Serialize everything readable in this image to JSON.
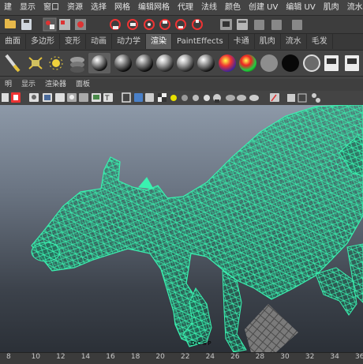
{
  "menu": [
    "建",
    "显示",
    "窗口",
    "资源",
    "选择",
    "网格",
    "编辑网格",
    "代理",
    "法线",
    "颜色",
    "创建 UV",
    "编辑 UV",
    "肌肉",
    "流水线缓"
  ],
  "shelf_tabs": [
    "曲面",
    "多边形",
    "变形",
    "动画",
    "动力学",
    "渲染",
    "PaintEffects",
    "卡通",
    "肌肉",
    "流水",
    "毛发"
  ],
  "active_shelf_tab": "渲染",
  "panel_menu": [
    "明",
    "显示",
    "渲染器",
    "面板"
  ],
  "timeline_ticks": [
    "8",
    "10",
    "12",
    "14",
    "16",
    "18",
    "20",
    "22",
    "24",
    "26",
    "28",
    "30",
    "32",
    "34",
    "36"
  ],
  "viewport_label": "D C S P",
  "colors": {
    "wireframe": "#2ee6a0",
    "shelf_tab_active": "#5d5d5d",
    "ui_background": "#444444"
  },
  "icons": {
    "status": [
      "folder-icon",
      "save-icon",
      "select-by-hierarchy-icon",
      "select-by-object-icon",
      "snap-grid-icon",
      "snap-curve-icon",
      "snap-point-icon",
      "snap-surface-icon",
      "history-icon",
      "render-icon",
      "ipr-render-icon",
      "render-settings-icon",
      "hypershade-icon"
    ],
    "shelf": [
      "paint-brush-icon",
      "light-icon",
      "sun-icon",
      "stack-icon",
      "sphere-shader-icon",
      "blinn-ball-icon",
      "phong-ball-icon",
      "lambert-ball-icon",
      "anisotropic-ball-icon",
      "ramp-ball-icon",
      "surface-ball-icon",
      "grey-ball-icon",
      "black-ball-icon",
      "white-ball-icon",
      "render-view-icon",
      "batch-render-icon",
      "hypershade-window-icon"
    ],
    "panel_toolbar": [
      "camera-icon",
      "lock-icon",
      "grid-icon",
      "wireframe-icon",
      "smooth-shade-icon",
      "texture-icon",
      "light-icon",
      "shadow-icon",
      "isolate-icon",
      "xray-icon",
      "resolution-gate-icon",
      "film-gate-icon",
      "safe-action-icon",
      "ambient-occlusion-icon",
      "motion-blur-icon",
      "antialias-icon",
      "depth-of-field-icon",
      "sequence-icon",
      "camera-attribute-icon"
    ]
  }
}
